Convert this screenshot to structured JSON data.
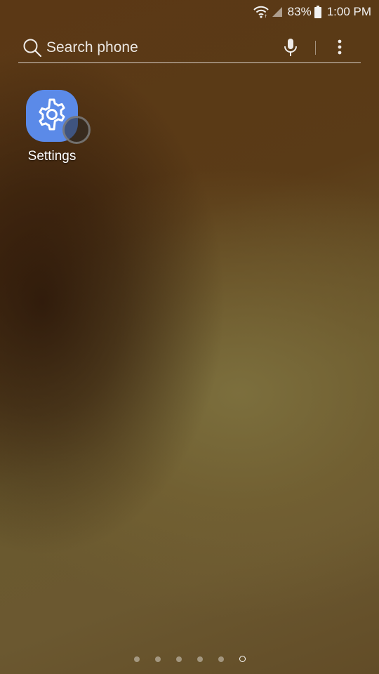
{
  "status_bar": {
    "battery_percent": "83%",
    "time": "1:00 PM",
    "icons": [
      "wifi-icon",
      "cellular-signal-icon",
      "battery-icon"
    ]
  },
  "search": {
    "placeholder": "Search phone",
    "icons": [
      "search-icon",
      "mic-icon",
      "more-options-icon"
    ]
  },
  "apps": [
    {
      "label": "Settings",
      "icon": "gear-icon",
      "tile_color": "#5b8ae8"
    }
  ],
  "page_indicator": {
    "page_count": 6,
    "current_page": 6
  }
}
